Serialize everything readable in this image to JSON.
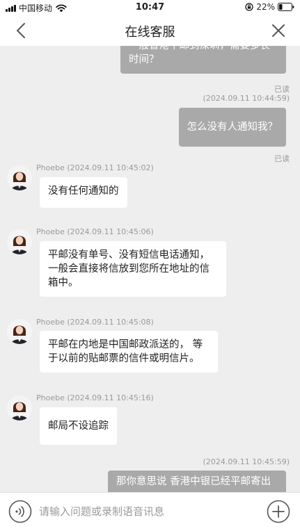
{
  "status_bar": {
    "carrier": "中国移动",
    "time": "10:47",
    "battery": "22%"
  },
  "nav": {
    "title": "在线客服"
  },
  "messages": {
    "out1": {
      "text_line1": "一般香港平邮到深圳，需要多长",
      "text_line2": "时间？",
      "read": "已读"
    },
    "stamp1": "(2024.09.11 10:44:59)",
    "out2": {
      "text": "怎么没有人通知我？",
      "read": "已读"
    },
    "in1": {
      "sender": "Phoebe (2024.09.11 10:45:02)",
      "text": "没有任何通知的"
    },
    "in2": {
      "sender": "Phoebe (2024.09.11 10:45:06)",
      "text_line1": "平邮没有单号、没有短信电话通知，",
      "text_line2": "一般会直接将信放到您所在地址的信",
      "text_line3": "箱中。"
    },
    "in3": {
      "sender": "Phoebe (2024.09.11 10:45:08)",
      "text_line1": "平邮在内地是中国邮政派送的， 等",
      "text_line2": "于以前的贴邮票的信件或明信片。"
    },
    "in4": {
      "sender": "Phoebe (2024.09.11 10:45:16)",
      "text": "邮局不设追踪"
    },
    "stamp2": "(2024.09.11 10:45:59)",
    "out3": {
      "text": "那你意思说 香港中银已经平邮寄出"
    }
  },
  "input": {
    "placeholder": "请输入问题或录制语音讯息"
  },
  "icons": {
    "back": "chevron-left-icon",
    "close": "close-icon",
    "voice": "voice-icon",
    "add": "plus-circle-icon"
  },
  "colors": {
    "bubble_out": "#a9a9a9",
    "bubble_in": "#ffffff",
    "chat_bg": "#eeeeee"
  }
}
